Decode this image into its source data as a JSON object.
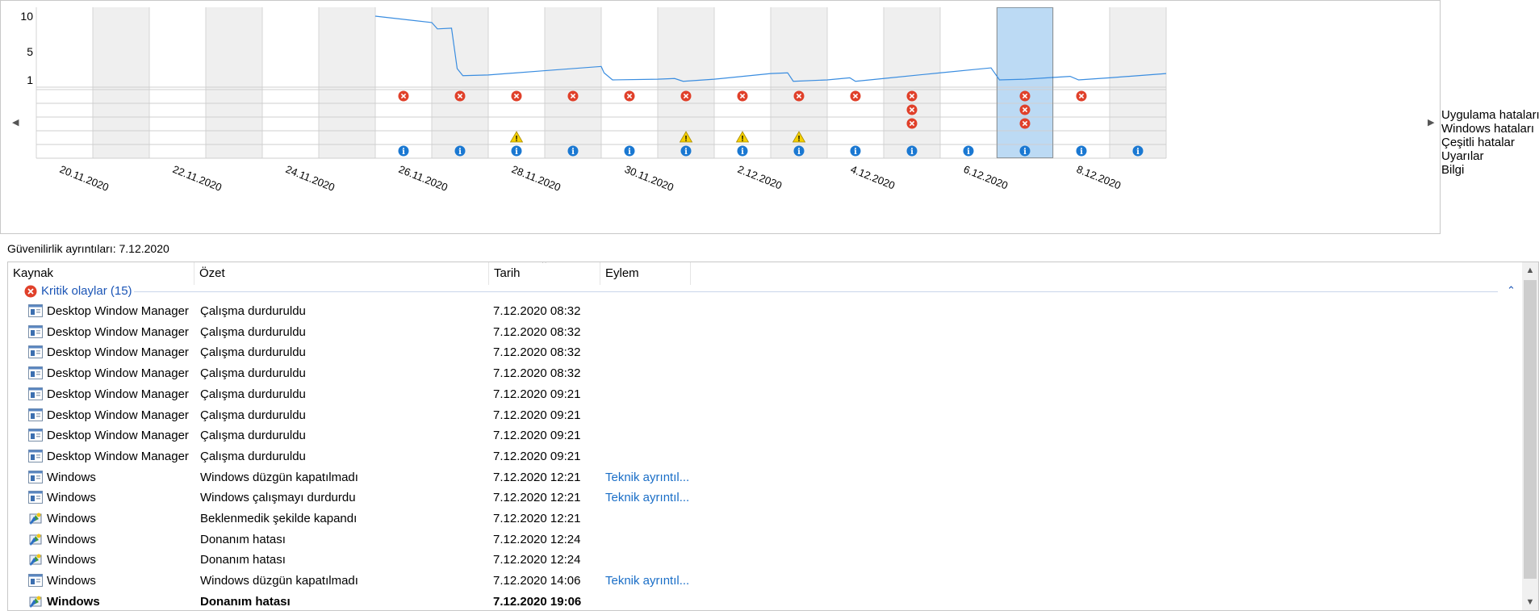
{
  "chart": {
    "y_ticks": [
      "10",
      "5",
      "1"
    ],
    "dates": [
      "20.11.2020",
      "22.11.2020",
      "24.11.2020",
      "26.11.2020",
      "28.11.2020",
      "30.11.2020",
      "2.12.2020",
      "4.12.2020",
      "6.12.2020",
      "8.12.2020"
    ],
    "columns": 20,
    "selected_column": 17,
    "shaded_columns": [
      1,
      3,
      5,
      7,
      9,
      11,
      13,
      15,
      17,
      19
    ],
    "legend": [
      "Uygulama hataları",
      "Windows hataları",
      "Çeşitli hatalar",
      "Uyarılar",
      "Bilgi"
    ],
    "markers": {
      "app_errors": [
        6,
        7,
        8,
        9,
        10,
        11,
        12,
        13,
        14,
        15,
        17,
        18
      ],
      "windows_errors": [
        15,
        17
      ],
      "misc_errors": [
        15,
        17
      ],
      "warnings": [
        8,
        11,
        12,
        13
      ],
      "info": [
        6,
        7,
        8,
        9,
        10,
        11,
        12,
        13,
        14,
        15,
        16,
        17,
        18,
        19
      ]
    },
    "nav_left": "◀",
    "nav_right": "▶"
  },
  "chart_data": {
    "type": "line",
    "title": "",
    "ylabel": "",
    "ylim": [
      0,
      10
    ],
    "y_ticks": [
      1,
      5,
      10
    ],
    "x_start_column": 6,
    "series": [
      {
        "points": [
          [
            6.0,
            10.0
          ],
          [
            7.0,
            9.1
          ],
          [
            7.1,
            8.2
          ],
          [
            7.35,
            8.3
          ],
          [
            7.45,
            2.6
          ],
          [
            7.55,
            1.6
          ],
          [
            8.0,
            1.7
          ],
          [
            9.0,
            2.3
          ],
          [
            10.0,
            2.9
          ],
          [
            10.05,
            2.0
          ],
          [
            10.2,
            1.0
          ],
          [
            11.0,
            1.1
          ],
          [
            11.3,
            1.2
          ],
          [
            11.45,
            0.8
          ],
          [
            12.0,
            1.1
          ],
          [
            13.0,
            1.9
          ],
          [
            13.3,
            2.0
          ],
          [
            13.4,
            0.8
          ],
          [
            14.0,
            1.0
          ],
          [
            14.4,
            1.3
          ],
          [
            14.5,
            0.8
          ],
          [
            15.0,
            1.2
          ],
          [
            16.0,
            2.0
          ],
          [
            16.9,
            2.7
          ],
          [
            17.05,
            1.0
          ],
          [
            17.5,
            1.1
          ],
          [
            18.3,
            1.5
          ],
          [
            18.45,
            1.0
          ],
          [
            19.0,
            1.3
          ],
          [
            20.0,
            1.9
          ]
        ]
      }
    ]
  },
  "details": {
    "title": "Güvenilirlik ayrıntıları: 7.12.2020",
    "columns": [
      "Kaynak",
      "Özet",
      "Tarih",
      "Eylem"
    ],
    "group": {
      "label": "Kritik olaylar (15)",
      "collapse": "⌃"
    },
    "rows": [
      {
        "icon": "app-window-icon",
        "source": "Desktop Window Manager",
        "summary": "Çalışma durduruldu",
        "date": "7.12.2020 08:32",
        "action": "",
        "bold": false
      },
      {
        "icon": "app-window-icon",
        "source": "Desktop Window Manager",
        "summary": "Çalışma durduruldu",
        "date": "7.12.2020 08:32",
        "action": "",
        "bold": false
      },
      {
        "icon": "app-window-icon",
        "source": "Desktop Window Manager",
        "summary": "Çalışma durduruldu",
        "date": "7.12.2020 08:32",
        "action": "",
        "bold": false
      },
      {
        "icon": "app-window-icon",
        "source": "Desktop Window Manager",
        "summary": "Çalışma durduruldu",
        "date": "7.12.2020 08:32",
        "action": "",
        "bold": false
      },
      {
        "icon": "app-window-icon",
        "source": "Desktop Window Manager",
        "summary": "Çalışma durduruldu",
        "date": "7.12.2020 09:21",
        "action": "",
        "bold": false
      },
      {
        "icon": "app-window-icon",
        "source": "Desktop Window Manager",
        "summary": "Çalışma durduruldu",
        "date": "7.12.2020 09:21",
        "action": "",
        "bold": false
      },
      {
        "icon": "app-window-icon",
        "source": "Desktop Window Manager",
        "summary": "Çalışma durduruldu",
        "date": "7.12.2020 09:21",
        "action": "",
        "bold": false
      },
      {
        "icon": "app-window-icon",
        "source": "Desktop Window Manager",
        "summary": "Çalışma durduruldu",
        "date": "7.12.2020 09:21",
        "action": "",
        "bold": false
      },
      {
        "icon": "app-window-icon",
        "source": "Windows",
        "summary": "Windows düzgün kapatılmadı",
        "date": "7.12.2020 12:21",
        "action": "Teknik ayrıntıl...",
        "bold": false
      },
      {
        "icon": "app-window-icon",
        "source": "Windows",
        "summary": "Windows çalışmayı durdurdu",
        "date": "7.12.2020 12:21",
        "action": "Teknik ayrıntıl...",
        "bold": false
      },
      {
        "icon": "windows-setup-icon",
        "source": "Windows",
        "summary": "Beklenmedik şekilde kapandı",
        "date": "7.12.2020 12:21",
        "action": "",
        "bold": false
      },
      {
        "icon": "windows-setup-icon",
        "source": "Windows",
        "summary": "Donanım hatası",
        "date": "7.12.2020 12:24",
        "action": "",
        "bold": false
      },
      {
        "icon": "windows-setup-icon",
        "source": "Windows",
        "summary": "Donanım hatası",
        "date": "7.12.2020 12:24",
        "action": "",
        "bold": false
      },
      {
        "icon": "app-window-icon",
        "source": "Windows",
        "summary": "Windows düzgün kapatılmadı",
        "date": "7.12.2020 14:06",
        "action": "Teknik ayrıntıl...",
        "bold": false
      },
      {
        "icon": "windows-setup-icon",
        "source": "Windows",
        "summary": "Donanım hatası",
        "date": "7.12.2020 19:06",
        "action": "",
        "bold": true
      }
    ]
  },
  "colors": {
    "error": "#e0402a",
    "warning": "#f5d000",
    "info": "#1a78d2",
    "line": "#3a8de0",
    "selected": "#bcdaf4",
    "shaded": "#efefef",
    "link": "#1a6ec7"
  }
}
